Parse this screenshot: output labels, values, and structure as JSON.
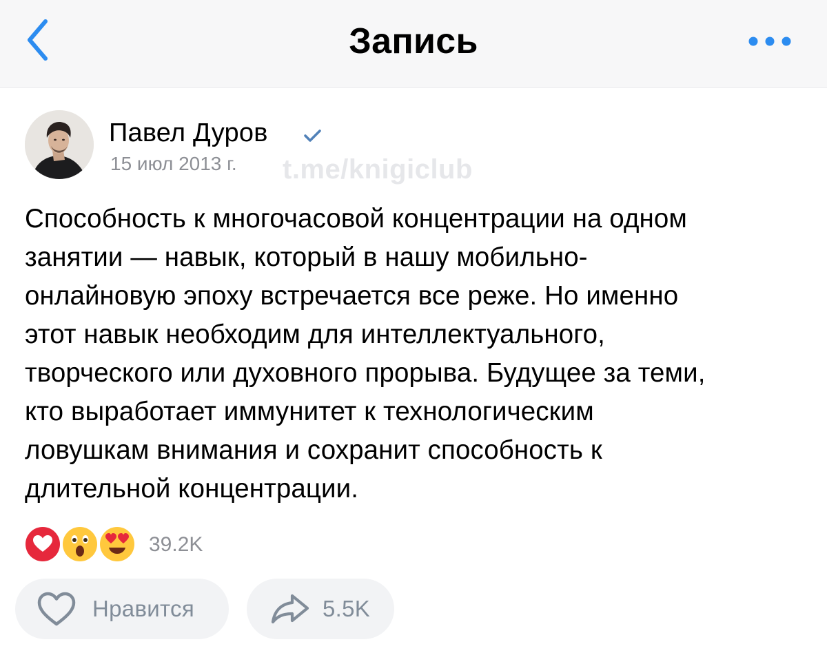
{
  "navbar": {
    "title": "Запись",
    "back_icon": "chevron-left-icon",
    "more_icon": "more-horizontal-icon",
    "accent": "#2c8cf0"
  },
  "post": {
    "author": {
      "name": "Павел Дуров",
      "verified": true,
      "verified_color": "#5181b8"
    },
    "date": "15 июл 2013 г.",
    "watermark": "t.me/knigiclub",
    "text_lines": [
      "Способность к многочасовой  концентрации на одном",
      "занятии — навык, который в нашу мобильно-",
      "онлайновую эпоху встречается все реже. Но именно",
      "этот навык необходим для интеллектуального,",
      "творческого или духовного прорыва. Будущее за теми,",
      "кто выработает иммунитет к технологическим",
      "ловушкам внимания и сохранит способность к",
      "длительной концентрации."
    ],
    "reactions": {
      "icons": [
        "heart-reaction-icon",
        "surprised-face-reaction-icon",
        "heart-eyes-reaction-icon"
      ],
      "count": "39.2K"
    },
    "actions": {
      "like_label": "Нравится",
      "like_icon": "heart-outline-icon",
      "share_count": "5.5K",
      "share_icon": "share-arrow-icon"
    }
  },
  "colors": {
    "secondary_text": "#8d8f95",
    "button_bg": "#f2f3f5",
    "button_text": "#818c99",
    "reaction_red": "#e6283c",
    "emoji_yellow": "#ffc83d"
  }
}
